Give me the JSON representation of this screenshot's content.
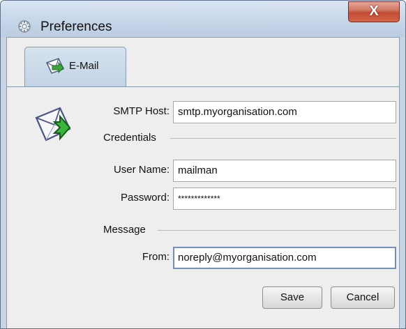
{
  "window": {
    "title": "Preferences",
    "close_label": "X"
  },
  "tabs": [
    {
      "label": "E-Mail",
      "icon": "mail-send-icon",
      "selected": true
    }
  ],
  "form": {
    "smtp_host": {
      "label": "SMTP Host:",
      "value": "smtp.myorganisation.com"
    },
    "credentials_section": "Credentials",
    "user_name": {
      "label": "User Name:",
      "value": "mailman"
    },
    "password": {
      "label": "Password:",
      "value": "*************"
    },
    "message_section": "Message",
    "from": {
      "label": "From:",
      "value": "noreply@myorganisation.com"
    }
  },
  "buttons": {
    "save": "Save",
    "cancel": "Cancel"
  },
  "colors": {
    "titlebar": "#c9d8ea",
    "close_button": "#c24b32",
    "tab": "#c1d3e6",
    "panel": "#eeeeee"
  }
}
